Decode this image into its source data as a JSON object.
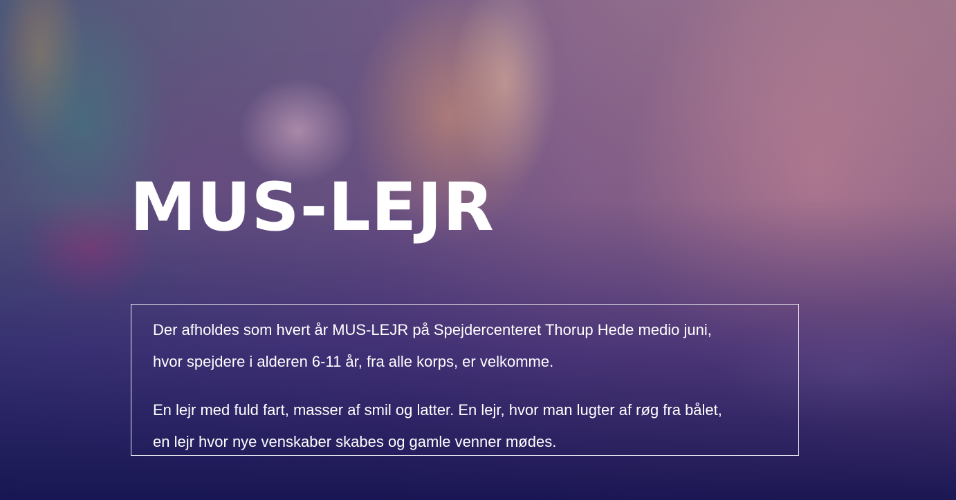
{
  "hero": {
    "title": "MUS-LEJR",
    "paragraphs": [
      "Der afholdes som hvert år MUS-LEJR på Spejdercenteret Thorup Hede medio juni, hvor spejdere i alderen 6-11 år, fra alle korps, er velkomme.",
      "En lejr med fuld fart, masser af smil og latter. En lejr, hvor man lugter af røg fra bålet, en lejr hvor nye venskaber skabes og gamle venner mødes."
    ]
  },
  "colors": {
    "text": "#ffffff",
    "overlay_bottom": "#14124f",
    "box_border": "#ffffff"
  }
}
